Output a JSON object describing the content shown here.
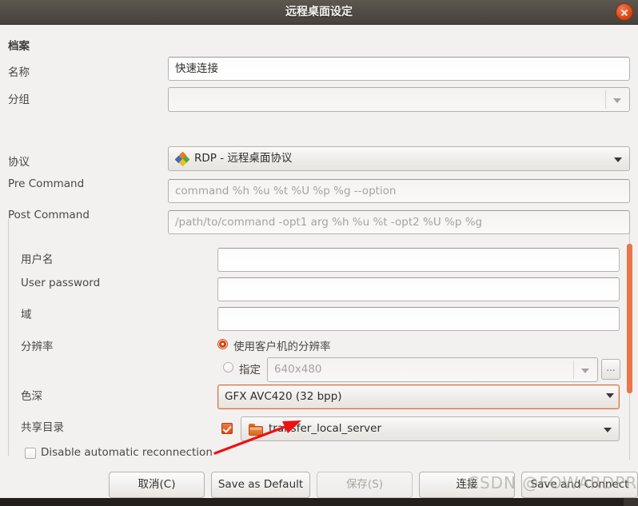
{
  "window": {
    "title": "远程桌面设定",
    "close_icon": "close-icon"
  },
  "form": {
    "section_title": "档案",
    "name": {
      "label": "名称",
      "value": "快速连接"
    },
    "group": {
      "label": "分组",
      "value": ""
    },
    "protocol": {
      "label": "协议",
      "value": "RDP - 远程桌面协议",
      "icon": "rdp-protocol-icon"
    },
    "pre_command": {
      "label": "Pre Command",
      "value": "",
      "placeholder": "command %h %u %t %U %p %g --option"
    },
    "post_command": {
      "label": "Post Command",
      "value": "",
      "placeholder": "/path/to/command -opt1 arg %h %u %t -opt2 %U %p %g"
    },
    "username": {
      "label": "用户名",
      "value": ""
    },
    "user_password": {
      "label": "User password",
      "value": ""
    },
    "domain": {
      "label": "域",
      "value": ""
    },
    "resolution": {
      "label": "分辨率",
      "option_client": "使用客户机的分辨率",
      "option_custom": "指定",
      "custom_placeholder": "640x480",
      "custom_value": "",
      "selected": "client",
      "browse_button": "..."
    },
    "color_depth": {
      "label": "色深",
      "value": "GFX AVC420 (32 bpp)"
    },
    "shared_folder": {
      "label": "共享目录",
      "enabled": true,
      "value": "transfer_local_server",
      "icon": "folder-icon"
    },
    "disable_reconnect": {
      "label": "Disable automatic reconnection",
      "checked": false
    }
  },
  "buttons": {
    "cancel": "取消(C)",
    "save_as_default": "Save as Default",
    "save": "保存(S)",
    "connect": "连接",
    "save_and_connect": "Save and Connect"
  },
  "watermark": "CSDN @FOWARDPROP",
  "colors": {
    "accent": "#dd4814",
    "titlebar": "#514c45",
    "background": "#f2f1f0",
    "scrollbar_thumb": "#e8764a",
    "annotation_arrow": "#ee1111"
  }
}
